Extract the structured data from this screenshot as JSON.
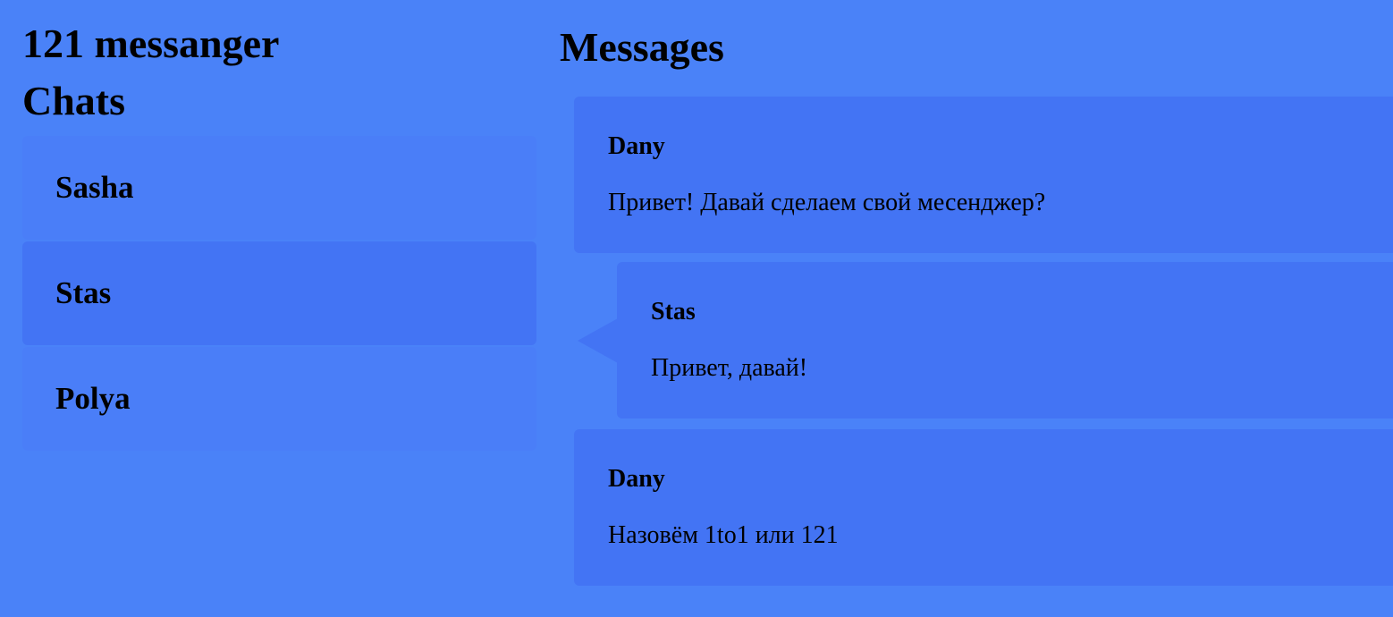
{
  "app": {
    "title": "121 messanger"
  },
  "sidebar": {
    "title": "Chats",
    "chats": [
      {
        "name": "Sasha",
        "active": false
      },
      {
        "name": "Stas",
        "active": true
      },
      {
        "name": "Polya",
        "active": false
      }
    ]
  },
  "main": {
    "title": "Messages",
    "messages": [
      {
        "author": "Dany",
        "text": "Привет! Давай сделаем свой месенджер?"
      },
      {
        "author": "Stas",
        "text": "Привет, давай!"
      },
      {
        "author": "Dany",
        "text": "Назовём 1to1 или 121"
      }
    ]
  },
  "colors": {
    "background": "#4a82f8",
    "chat_item": "#4a7ef8",
    "active_item": "#4374f4",
    "message_bubble": "#4374f4"
  }
}
